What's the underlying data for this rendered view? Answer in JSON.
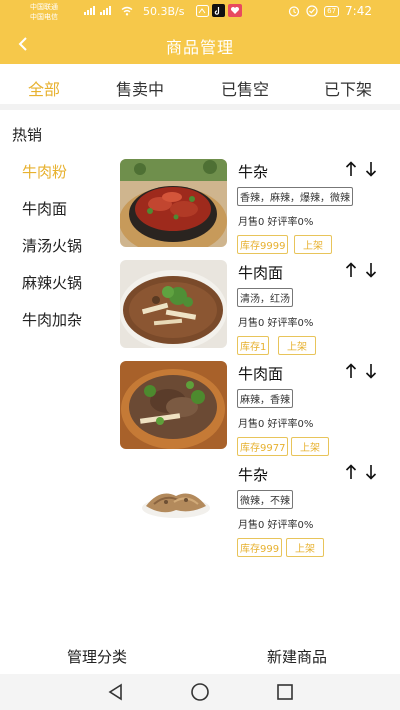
{
  "status_bar": {
    "carrier1": "中国联通",
    "carrier2": "中国电信",
    "speed": "50.3B/s",
    "battery": "67",
    "time": "7:42"
  },
  "header": {
    "title": "商品管理",
    "back_icon": "chevron-left-icon"
  },
  "tabs": [
    {
      "label": "全部"
    },
    {
      "label": "售卖中"
    },
    {
      "label": "已售空"
    },
    {
      "label": "已下架"
    }
  ],
  "section_title": "热销",
  "categories": [
    {
      "label": "牛肉粉"
    },
    {
      "label": "牛肉面"
    },
    {
      "label": "清汤火锅"
    },
    {
      "label": "麻辣火锅"
    },
    {
      "label": "牛肉加杂"
    }
  ],
  "products": [
    {
      "name": "牛杂",
      "tags": "香辣，麻辣，爆辣，微辣",
      "stats": "月售0 好评率0%",
      "stock": "库存9999",
      "action": "上架"
    },
    {
      "name": "牛肉面",
      "tags": "清汤，红汤",
      "stats": "月售0 好评率0%",
      "stock": "库存1",
      "action": "上架"
    },
    {
      "name": "牛肉面",
      "tags": "麻辣，香辣",
      "stats": "月售0 好评率0%",
      "stock": "库存9977",
      "action": "上架"
    },
    {
      "name": "牛杂",
      "tags": "微辣，不辣",
      "stats": "月售0 好评率0%",
      "stock": "库存999",
      "action": "上架"
    }
  ],
  "bottom": {
    "manage_categories": "管理分类",
    "new_product": "新建商品"
  },
  "colors": {
    "accent": "#f6c84a",
    "active_text": "#e7b12f"
  }
}
